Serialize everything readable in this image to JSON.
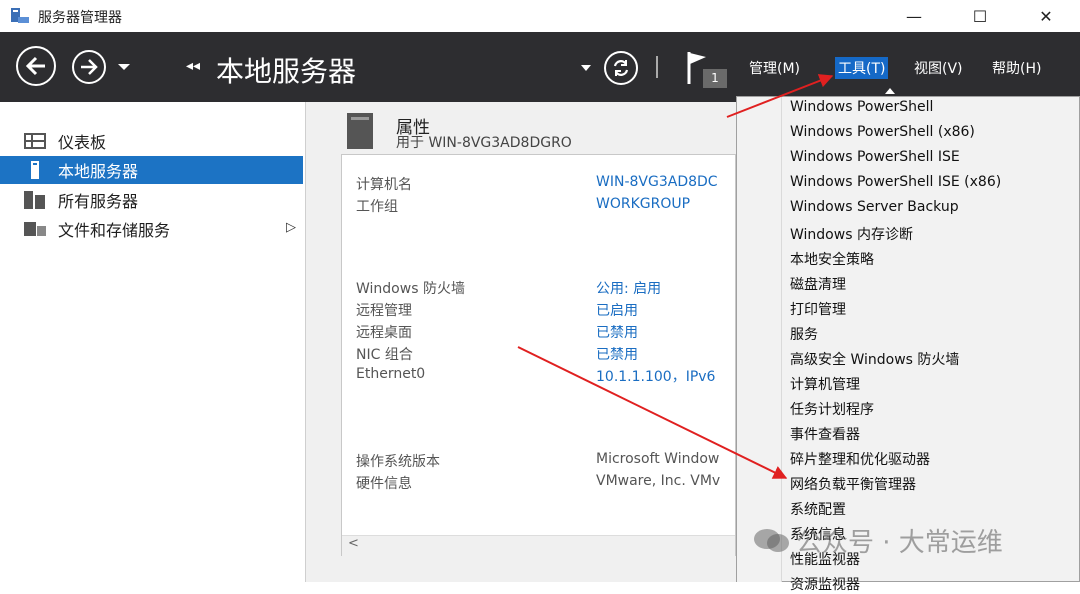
{
  "window": {
    "title": "服务器管理器",
    "minimize": "—",
    "maximize": "☐",
    "close": "✕"
  },
  "header": {
    "page_title": "本地服务器",
    "back_chevrons": "◂◂",
    "notification_count": "1",
    "menus": [
      "管理(M)",
      "工具(T)",
      "视图(V)",
      "帮助(H)"
    ]
  },
  "sidebar": {
    "items": [
      {
        "label": "仪表板",
        "icon": "dashboard-icon",
        "active": false
      },
      {
        "label": "本地服务器",
        "icon": "server-icon",
        "active": true
      },
      {
        "label": "所有服务器",
        "icon": "servers-icon",
        "active": false
      },
      {
        "label": "文件和存储服务",
        "icon": "storage-icon",
        "active": false,
        "expand": "▷"
      }
    ]
  },
  "properties": {
    "title": "属性",
    "subtitle": "用于 WIN-8VG3AD8DGRO",
    "rows": [
      {
        "label": "计算机名",
        "value": "WIN-8VG3AD8DC",
        "link": true
      },
      {
        "label": "工作组",
        "value": "WORKGROUP",
        "link": true
      },
      {
        "label": "Windows 防火墙",
        "value": "公用: 启用",
        "link": true
      },
      {
        "label": "远程管理",
        "value": "已启用",
        "link": true
      },
      {
        "label": "远程桌面",
        "value": "已禁用",
        "link": true
      },
      {
        "label": "NIC 组合",
        "value": "已禁用",
        "link": true
      },
      {
        "label": "Ethernet0",
        "value": "10.1.1.100，IPv6",
        "link": true
      },
      {
        "label": "操作系统版本",
        "value": "Microsoft Window",
        "link": false
      },
      {
        "label": "硬件信息",
        "value": "VMware, Inc. VMv",
        "link": false
      }
    ],
    "scroll_left": "<"
  },
  "tools_menu": {
    "items": [
      "Windows PowerShell",
      "Windows PowerShell (x86)",
      "Windows PowerShell ISE",
      "Windows PowerShell ISE (x86)",
      "Windows Server Backup",
      "Windows 内存诊断",
      "本地安全策略",
      "磁盘清理",
      "打印管理",
      "服务",
      "高级安全 Windows 防火墙",
      "计算机管理",
      "任务计划程序",
      "事件查看器",
      "碎片整理和优化驱动器",
      "网络负载平衡管理器",
      "系统配置",
      "系统信息",
      "性能监视器",
      "资源监视器"
    ]
  },
  "watermark": "公众号 · 大常运维",
  "colors": {
    "header_bg": "#2d2d30",
    "accent": "#1c73c4",
    "link": "#1a6dc2",
    "annotation_arrow": "#e02020"
  }
}
